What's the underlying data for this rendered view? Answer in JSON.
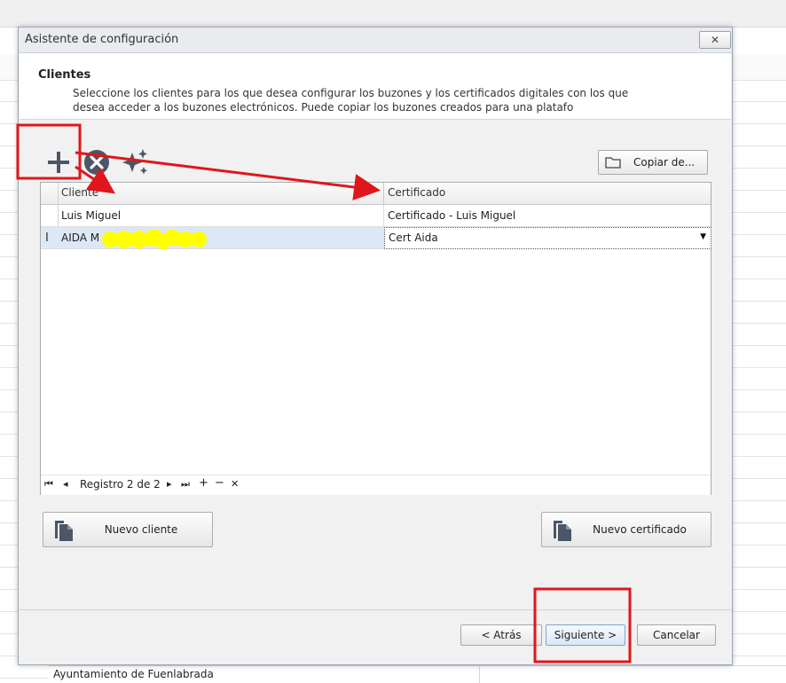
{
  "background": {
    "row_text": "Ayuntamiento de Fuenlabrada"
  },
  "dialog": {
    "title": "Asistente de configuración",
    "close_label": "✕",
    "section_title": "Clientes",
    "section_description": "Seleccione los clientes para los que desea configurar los buzones y los certificados digitales con los que desea acceder a los buzones electrónicos. Puede copiar los buzones creados para una platafo"
  },
  "toolbar": {
    "add_icon": "plus-icon",
    "remove_icon": "remove-circle-icon",
    "magic_icon": "sparkle-icon",
    "copy_label": "Copiar de..."
  },
  "grid": {
    "columns": [
      "Cliente",
      "Certificado"
    ],
    "rows": [
      {
        "cliente": "Luis Miguel",
        "certificado": "Certificado - Luis Miguel"
      },
      {
        "cliente": "AIDA M",
        "certificado": "Cert Aida"
      }
    ],
    "row_indicator": "I",
    "navigator": {
      "first": "⏮",
      "prev": "◂",
      "record_text": "Registro 2 de 2",
      "next": "▸",
      "last": "⏭",
      "add": "+",
      "remove": "−",
      "cancel": "✕"
    }
  },
  "buttons": {
    "new_client": "Nuevo cliente",
    "new_certificate": "Nuevo certificado",
    "back": "< Atrás",
    "next": "Siguiente >",
    "cancel": "Cancelar"
  },
  "colors": {
    "annotation_red": "#e0161c",
    "redaction_yellow": "#ffff00",
    "selected_row": "#dde8f6"
  }
}
